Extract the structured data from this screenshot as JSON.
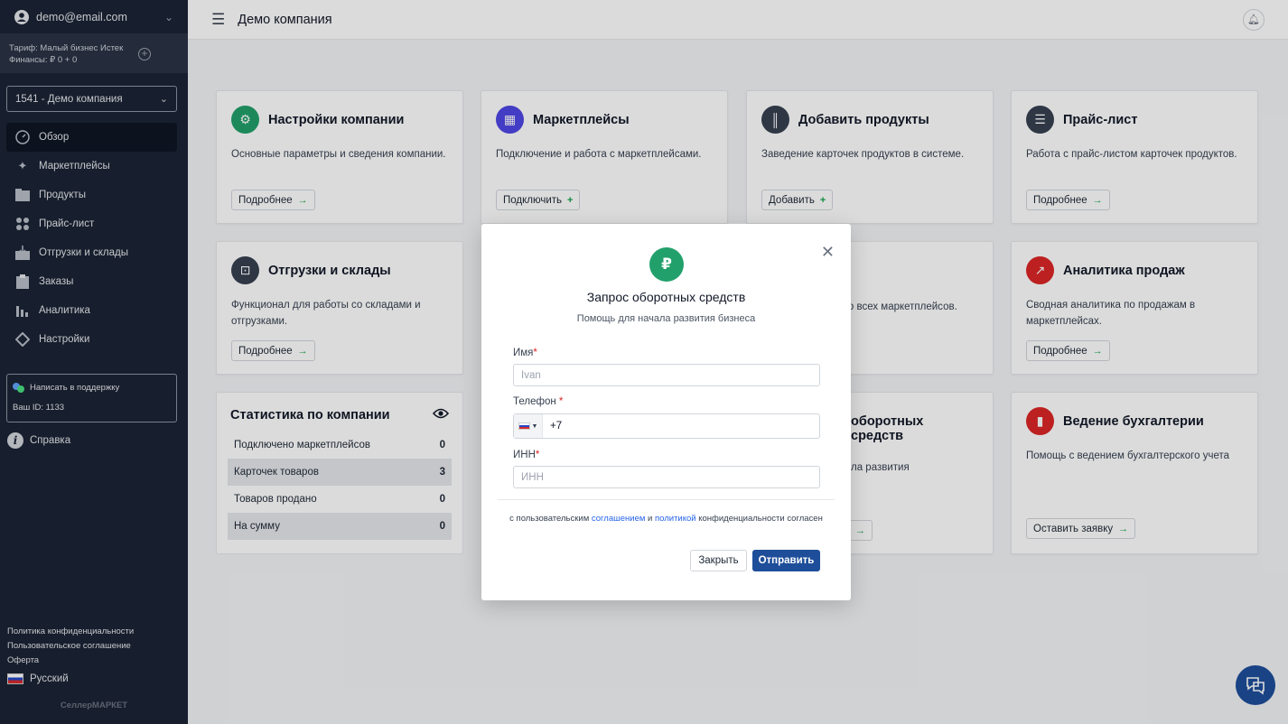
{
  "sidebar": {
    "user_email": "demo@email.com",
    "plan_line": "Тариф: Малый бизнес Истек",
    "finance_line": "Финансы: ₽ 0 + 0",
    "company_select": "1541 - Демо компания",
    "menu": [
      {
        "label": "Обзор",
        "icon": "dashboard-icon"
      },
      {
        "label": "Маркетплейсы",
        "icon": "sparkle-icon"
      },
      {
        "label": "Продукты",
        "icon": "folder-icon"
      },
      {
        "label": "Прайс-лист",
        "icon": "dots-grid-icon"
      },
      {
        "label": "Отгрузки и склады",
        "icon": "warehouse-icon"
      },
      {
        "label": "Заказы",
        "icon": "clipboard-icon"
      },
      {
        "label": "Аналитика",
        "icon": "bar-chart-icon"
      },
      {
        "label": "Настройки",
        "icon": "settings-diamond-icon"
      }
    ],
    "support_label": "Написать в поддержку",
    "user_id_label": "Ваш ID: 1133",
    "help_label": "Справка",
    "footer_links": [
      "Политика конфиденциальности",
      "Пользовательское соглашение",
      "Оферта"
    ],
    "language": "Русский",
    "brand": "СеллерМАРКЕТ"
  },
  "header": {
    "title": "Демо компания"
  },
  "cards": [
    {
      "title": "Настройки компании",
      "desc": "Основные параметры и сведения компании.",
      "button": "Подробнее",
      "arrow": "→",
      "icon_color": "#22a06b",
      "icon": "⚙"
    },
    {
      "title": "Маркетплейсы",
      "desc": "Подключение и работа с маркетплейсами.",
      "button": "Подключить",
      "arrow": "+",
      "icon_color": "#4f46e5",
      "icon": "▦"
    },
    {
      "title": "Добавить продукты",
      "desc": "Заведение карточек продуктов в системе.",
      "button": "Добавить",
      "arrow": "+",
      "icon_color": "#374151",
      "icon": "║"
    },
    {
      "title": "Прайс-лист",
      "desc": "Работа с прайс-листом карточек продуктов.",
      "button": "Подробнее",
      "arrow": "→",
      "icon_color": "#374151",
      "icon": "☰"
    },
    {
      "title": "Отгрузки и склады",
      "desc": "Функционал для работы со складами и отгрузками.",
      "button": "Подробнее",
      "arrow": "→",
      "icon_color": "#374151",
      "icon": "⊡"
    },
    {
      "title": "",
      "desc": "со всех маркетплейсов.",
      "button": "",
      "arrow": "",
      "icon_color": "#ffffff",
      "icon": ""
    },
    {
      "title": "Аналитика продаж",
      "desc": "Сводная аналитика по продажам в маркетплейсах.",
      "button": "Подробнее",
      "arrow": "→",
      "icon_color": "#dc2626",
      "icon": "↗"
    },
    {
      "title": "оборотных средств",
      "desc": "ла развития",
      "button": "",
      "arrow": "→",
      "icon_color": "#ffffff",
      "icon": ""
    },
    {
      "title": "Ведение бухгалтерии",
      "desc": "Помощь с ведением бухгалтерского учета",
      "button": "Оставить заявку",
      "arrow": "→",
      "icon_color": "#dc2626",
      "icon": "▮"
    }
  ],
  "stats": {
    "title": "Статистика по компании",
    "rows": [
      {
        "label": "Подключено маркетплейсов",
        "value": "0"
      },
      {
        "label": "Карточек товаров",
        "value": "3"
      },
      {
        "label": "Товаров продано",
        "value": "0"
      },
      {
        "label": "На сумму",
        "value": "0"
      }
    ]
  },
  "modal": {
    "icon_symbol": "₽",
    "title": "Запрос оборотных средств",
    "subtitle": "Помощь для начала развития бизнеса",
    "name_label": "Имя",
    "name_placeholder": "Ivan",
    "phone_label": "Телефон",
    "phone_value": "+7",
    "inn_label": "ИНН",
    "inn_placeholder": "ИНН",
    "required_mark": "*",
    "consent_prefix": "с пользовательским",
    "consent_link1": "соглашением",
    "consent_and": "и",
    "consent_link2": "политикой",
    "consent_suffix": "конфиденциальности согласен",
    "close_button": "Закрыть",
    "submit_button": "Отправить"
  }
}
